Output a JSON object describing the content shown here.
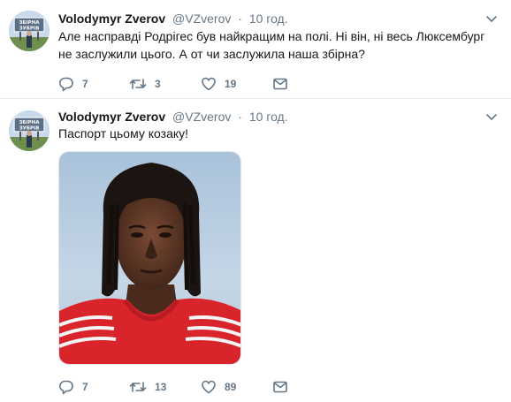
{
  "tweets": [
    {
      "author_name": "Volodymyr Zverov",
      "handle": "@VZverov",
      "separator": "·",
      "time": "10 год.",
      "text": "Але насправді Родрігес був найкращим на полі. Ні він, ні весь Люксембург не заслужили цього. А от чи заслужила наша збірна?",
      "replies": "7",
      "retweets": "3",
      "likes": "19"
    },
    {
      "author_name": "Volodymyr Zverov",
      "handle": "@VZverov",
      "separator": "·",
      "time": "10 год.",
      "text": "Паспорт цьому козаку!",
      "media": {
        "kind": "photo",
        "description_icon": "player-portrait-photo"
      },
      "replies": "7",
      "retweets": "13",
      "likes": "89"
    }
  ],
  "avatar": {
    "sign_line1": "ЗБІРНА",
    "sign_line2": "ЗУБРІВ"
  },
  "colors": {
    "text": "#14171a",
    "muted": "#657786",
    "border": "#e6ecf0"
  }
}
